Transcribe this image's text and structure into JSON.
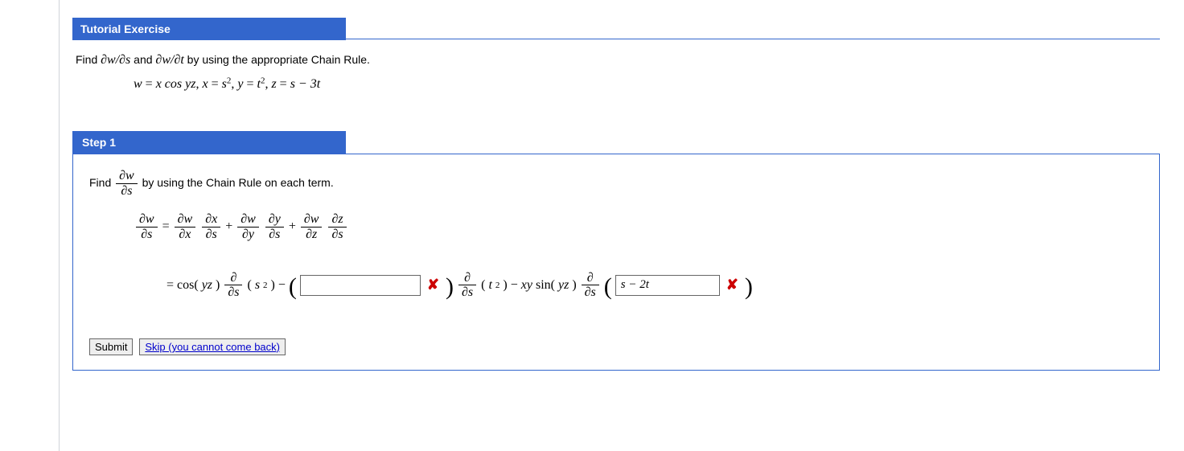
{
  "tutorial": {
    "header": "Tutorial Exercise",
    "prompt_prefix": "Find ",
    "prompt_d1": "∂w/∂s",
    "prompt_and": " and ",
    "prompt_d2": "∂w/∂t",
    "prompt_suffix": " by using the appropriate Chain Rule.",
    "equation": {
      "w_lhs": "w",
      "eq": " = ",
      "w_rhs": "x cos yz",
      "sep": ", ",
      "x_lhs": "x",
      "x_rhs_base": "s",
      "x_rhs_exp": "2",
      "y_lhs": "y",
      "y_rhs_base": "t",
      "y_rhs_exp": "2",
      "z_lhs": "z",
      "z_rhs": "s − 3t"
    }
  },
  "step": {
    "header": "Step 1",
    "intro_prefix": "Find ",
    "intro_frac_num": "∂w",
    "intro_frac_den": "∂s",
    "intro_suffix": " by using the Chain Rule on each term.",
    "chain": {
      "lhs_num": "∂w",
      "lhs_den": "∂s",
      "eq": " = ",
      "t1a_num": "∂w",
      "t1a_den": "∂x",
      "t1b_num": "∂x",
      "t1b_den": "∂s",
      "plus": " + ",
      "t2a_num": "∂w",
      "t2a_den": "∂y",
      "t2b_num": "∂y",
      "t2b_den": "∂s",
      "t3a_num": "∂w",
      "t3a_den": "∂z",
      "t3b_num": "∂z",
      "t3b_den": "∂s"
    },
    "expand": {
      "eq": "= ",
      "part1_fn": "cos(",
      "part1_arg": "yz",
      "part1_close": ")",
      "d_num": "∂",
      "d_den": "∂s",
      "part1_of_open": "(",
      "part1_of_base": "s",
      "part1_of_exp": "2",
      "part1_of_close": ")",
      "minus": " − ",
      "blank1_value": "",
      "mid_of_base": "t",
      "mid_of_exp": "2",
      "mid_minus": " − ",
      "mid_coef": "xy",
      "mid_fn": " sin(",
      "mid_arg": "yz",
      "mid_close": ") ",
      "blank2_value": "s − 2t"
    },
    "feedback": {
      "blank1_correct": false,
      "blank2_correct": false
    }
  },
  "buttons": {
    "submit": "Submit",
    "skip": "Skip (you cannot come back)"
  },
  "icons": {
    "wrong": "✘"
  }
}
